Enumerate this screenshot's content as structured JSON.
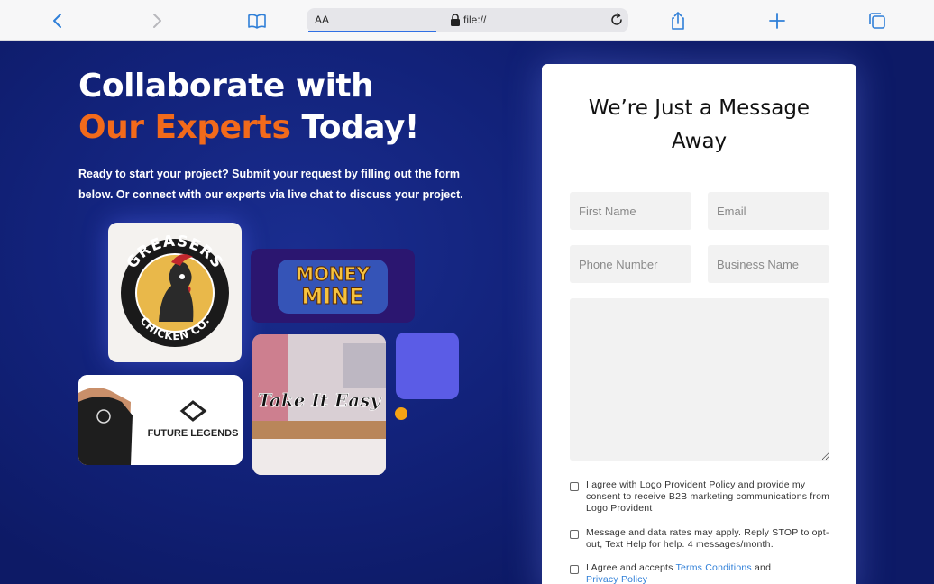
{
  "browser": {
    "text_size_label": "AA",
    "url": "file://"
  },
  "hero": {
    "headline_line1": "Collaborate with",
    "headline_accent": "Our Experts",
    "headline_end": " Today!",
    "intro_line1": "Ready to start your project? Submit your request by filling out the form",
    "intro_line2": "below. Or connect with our experts via live chat to discuss your project.",
    "portfolio": {
      "greasers_top": "GREASERS",
      "greasers_bottom": "CHICKEN CO.",
      "money_line1": "MONEY",
      "money_line2": "MINE",
      "legends_text": "FUTURE LEGENDS",
      "easy_text": "Take It Easy"
    }
  },
  "form": {
    "title_line1": "We’re Just a Message",
    "title_line2": "Away",
    "first_name_placeholder": "First Name",
    "email_placeholder": "Email",
    "phone_placeholder": "Phone Number",
    "business_placeholder": "Business Name",
    "message_placeholder": "",
    "consent1": "I agree with Logo Provident Policy and provide my consent to receive B2B marketing communications from Logo Provident",
    "consent2": "Message and data rates may apply. Reply STOP to opt-out, Text Help for help. 4 messages/month.",
    "consent3_prefix": "I Agree and accepts ",
    "terms_link": "Terms Conditions",
    "consent3_and": " and",
    "privacy_link": "Privacy Policy"
  },
  "colors": {
    "accent_orange": "#f26a1b",
    "hero_blue": "#12227a",
    "purple": "#5b5ce6",
    "dot_yellow": "#f5a313",
    "link_blue": "#2f7fd8"
  }
}
